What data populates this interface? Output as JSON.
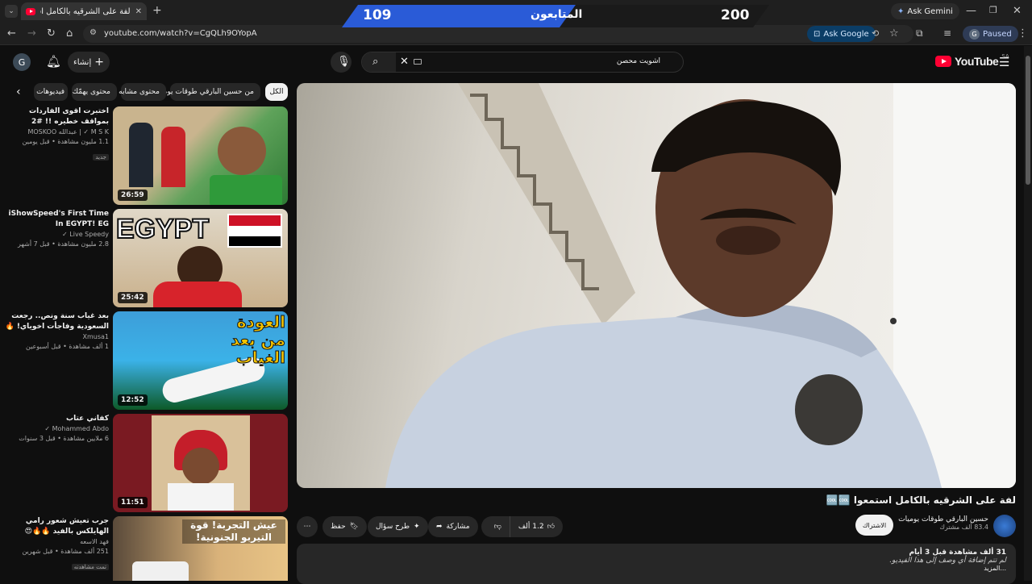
{
  "browser": {
    "tab_title": "لفة على الشرقيه  بالكامل استمعوا",
    "url": "youtube.com/watch?v=CgQLh9OYopA",
    "ask_gemini": "Ask Gemini",
    "ask_google": "Ask Google",
    "profile_initial": "G",
    "paused": "Paused"
  },
  "overlay": {
    "current": "109",
    "label": "المتابعون",
    "goal": "200",
    "colors": {
      "blue": "#2a5bd7",
      "dark": "#1c1c1c"
    }
  },
  "youtube": {
    "logo_text": "YouTube",
    "region": "SA",
    "search_value": "اشويت محصن",
    "create_label": "إنشاء",
    "avatar_initial": "G",
    "chips": [
      "الكل",
      "من حسين البارقي طوقات يوميات",
      "محتوى مشابه",
      "محتوى يهمّك",
      "فيديوهات"
    ],
    "related": [
      {
        "title": "اختبرت اقوى الفاردات بمواقف خطيره !! #2",
        "channel": "M S K ✓ | عبدالله MOSKOO",
        "meta": "1.1 مليون مشاهدة • قبل يومين",
        "badge": "جديد",
        "duration": "26:59",
        "thumb_caption": ""
      },
      {
        "title": "iShowSpeed's First Time In EGYPT! EG",
        "channel": "Live Speedy ✓",
        "meta": "2.8 مليون مشاهدة • قبل 7 أشهر",
        "badge": "",
        "duration": "25:42",
        "thumb_caption": "EGYPT"
      },
      {
        "title": "بعد غياب سنة ونص.. رجعت السعودية وفاجأت اخوياي! 🔥",
        "channel": "Xmusa1",
        "meta": "1 ألف مشاهدة • قبل أسبوعين",
        "badge": "",
        "duration": "12:52",
        "thumb_caption": "العودة من بعد الغياب"
      },
      {
        "title": "كفاني عتاب",
        "channel": "Mohammed Abdo ✓",
        "meta": "6 ملايين مشاهدة • قبل 3 سنوات",
        "badge": "",
        "duration": "11:51",
        "thumb_caption": ""
      },
      {
        "title": "جرب تعيش شعور رامي الهايلكس بالفيد 🔥🔥😍",
        "channel": "فهد الاسعه",
        "meta": "251 ألف مشاهدة • قبل شهرين",
        "badge": "تمت مشاهدته",
        "duration": "",
        "thumb_caption": "عيش التجربة! قوة التيربو الجنونية!"
      }
    ],
    "video": {
      "title": "لفة على الشرقيه  بالكامل استمعوا 🆒🆒",
      "channel": "حسين البارقي طوقات يوميات",
      "subscribers": "83.4 ألف مشترك",
      "subscribe": "الاشتراك",
      "likes": "1.2 ألف",
      "share": "مشاركة",
      "ask": "طرح سؤال",
      "save": "حفظ",
      "views": "31 ألف مشاهدة  قبل 3 أيام",
      "description": "لم تتم إضافة أي وصف إلى هذا الفيديو.",
      "more": "...المزيد"
    }
  }
}
